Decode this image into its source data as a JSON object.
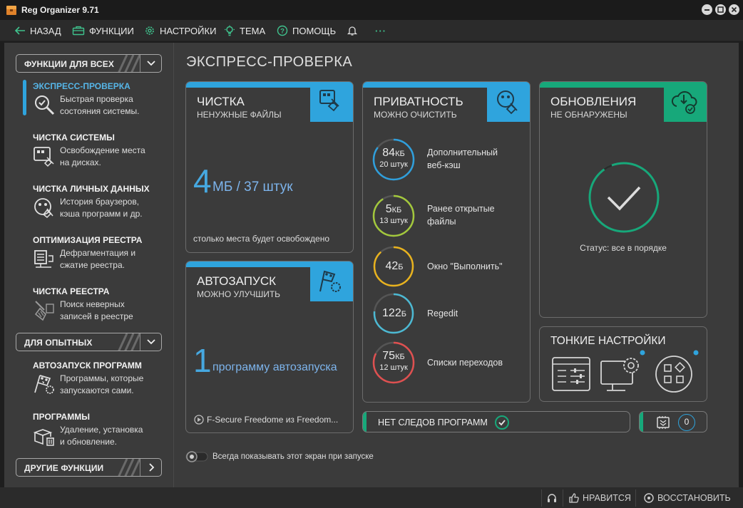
{
  "window": {
    "title": "Reg Organizer 9.71"
  },
  "toolbar": {
    "back": "НАЗАД",
    "functions": "ФУНКЦИИ",
    "settings": "НАСТРОЙКИ",
    "theme": "ТЕМА",
    "help": "ПОМОЩЬ",
    "more": "···"
  },
  "sidebar": {
    "group1": "ФУНКЦИИ ДЛЯ ВСЕХ",
    "group2": "ДЛЯ ОПЫТНЫХ",
    "group3": "ДРУГИЕ ФУНКЦИИ",
    "items": [
      {
        "title": "ЭКСПРЕСС-ПРОВЕРКА",
        "desc1": "Быстрая проверка",
        "desc2": "состояния системы."
      },
      {
        "title": "ЧИСТКА СИСТЕМЫ",
        "desc1": "Освобождение места",
        "desc2": "на дисках."
      },
      {
        "title": "ЧИСТКА ЛИЧНЫХ ДАННЫХ",
        "desc1": "История браузеров,",
        "desc2": "кэша программ и др."
      },
      {
        "title": "ОПТИМИЗАЦИЯ РЕЕСТРА",
        "desc1": "Дефрагментация и",
        "desc2": "сжатие реестра."
      },
      {
        "title": "ЧИСТКА РЕЕСТРА",
        "desc1": "Поиск неверных",
        "desc2": "записей в реестре"
      },
      {
        "title": "АВТОЗАПУСК ПРОГРАММ",
        "desc1": "Программы, которые",
        "desc2": "запускаются сами."
      },
      {
        "title": "ПРОГРАММЫ",
        "desc1": "Удаление, установка",
        "desc2": "и обновление."
      }
    ]
  },
  "main": {
    "title": "ЭКСПРЕСС-ПРОВЕРКА",
    "cleaning": {
      "title": "ЧИСТКА",
      "subtitle": "НЕНУЖНЫЕ ФАЙЛЫ",
      "amount": "4",
      "detail": "МБ / 37 штук",
      "note": "столько места будет освобождено"
    },
    "autorun": {
      "title": "АВТОЗАПУСК",
      "subtitle": "МОЖНО УЛУЧШИТЬ",
      "amount": "1",
      "detail": "программу автозапуска",
      "note": "F-Secure Freedome из Freedom..."
    },
    "privacy": {
      "title": "ПРИВАТНОСТЬ",
      "subtitle": "МОЖНО ОЧИСТИТЬ",
      "items": [
        {
          "value": "84",
          "unit": "КБ",
          "count": "20 штук",
          "label1": "Дополнительный",
          "label2": "веб-кэш",
          "color": "#2f9fdc"
        },
        {
          "value": "5",
          "unit": "КБ",
          "count": "13 штук",
          "label1": "Ранее открытые",
          "label2": "файлы",
          "color": "#a3c83c"
        },
        {
          "value": "42",
          "unit": "Б",
          "count": "",
          "label1": "Окно \"Выполнить\"",
          "label2": "",
          "color": "#e8b21e"
        },
        {
          "value": "122",
          "unit": "Б",
          "count": "",
          "label1": "Regedit",
          "label2": "",
          "color": "#4cb9d3"
        },
        {
          "value": "75",
          "unit": "КБ",
          "count": "12 штук",
          "label1": "Списки переходов",
          "label2": "",
          "color": "#df5050"
        }
      ]
    },
    "updates": {
      "title": "ОБНОВЛЕНИЯ",
      "subtitle": "НЕ ОБНАРУЖЕНЫ",
      "status": "Статус: все в порядке"
    },
    "fine_tuning": {
      "title": "ТОНКИЕ НАСТРОЙКИ"
    },
    "no_traces": {
      "label": "НЕТ СЛЕДОВ ПРОГРАММ"
    },
    "counter": {
      "value": "0"
    },
    "show_on_start": "Всегда показывать этот экран при запуске"
  },
  "statusbar": {
    "like": "НРАВИТСЯ",
    "restore": "ВОССТАНОВИТЬ"
  },
  "colors": {
    "blue": "#2fa4dd",
    "green": "#17a87a"
  }
}
